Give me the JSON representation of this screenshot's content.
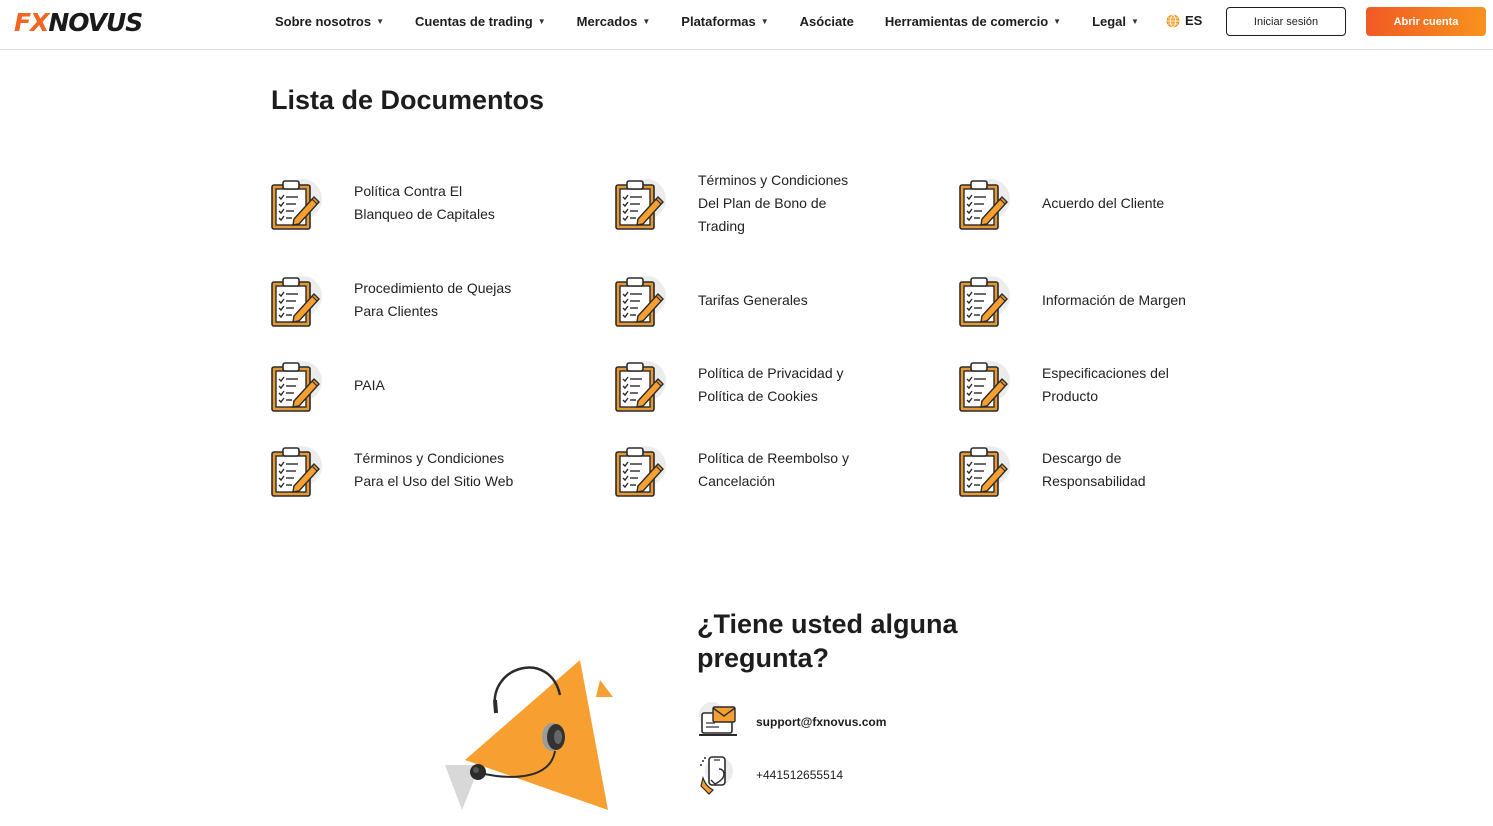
{
  "brand": {
    "logo_fx": "FX",
    "logo_novus": "NOVUS",
    "accent": "#f26522",
    "accent2": "#f7931e"
  },
  "nav": {
    "items": [
      {
        "label": "Sobre nosotros",
        "dropdown": true
      },
      {
        "label": "Cuentas de trading",
        "dropdown": true
      },
      {
        "label": "Mercados",
        "dropdown": true
      },
      {
        "label": "Plataformas",
        "dropdown": true
      },
      {
        "label": "Asóciate",
        "dropdown": false
      },
      {
        "label": "Herramientas de comercio",
        "dropdown": true
      },
      {
        "label": "Legal",
        "dropdown": true
      }
    ],
    "language": "ES",
    "login_label": "Iniciar sesión",
    "open_account_label": "Abrir cuenta"
  },
  "documents": {
    "title": "Lista de Documentos",
    "icon": "clipboard-checklist-icon",
    "items": [
      {
        "label": "Política Contra El Blanqueo de Capitales"
      },
      {
        "label": "Términos y Condiciones Del Plan de Bono de Trading"
      },
      {
        "label": "Acuerdo del Cliente"
      },
      {
        "label": "Procedimiento de Quejas Para Clientes"
      },
      {
        "label": "Tarifas Generales"
      },
      {
        "label": "Información de Margen"
      },
      {
        "label": "PAIA"
      },
      {
        "label": "Política de Privacidad y Política de Cookies"
      },
      {
        "label": "Especificaciones del Producto"
      },
      {
        "label": "Términos y Condiciones Para el Uso del Sitio Web"
      },
      {
        "label": "Política de Reembolso y Cancelación"
      },
      {
        "label": "Descargo de Responsabilidad"
      }
    ]
  },
  "contact": {
    "title": "¿Tiene usted alguna pregunta?",
    "email": "support@fxnovus.com",
    "phone": "+441512655514"
  }
}
